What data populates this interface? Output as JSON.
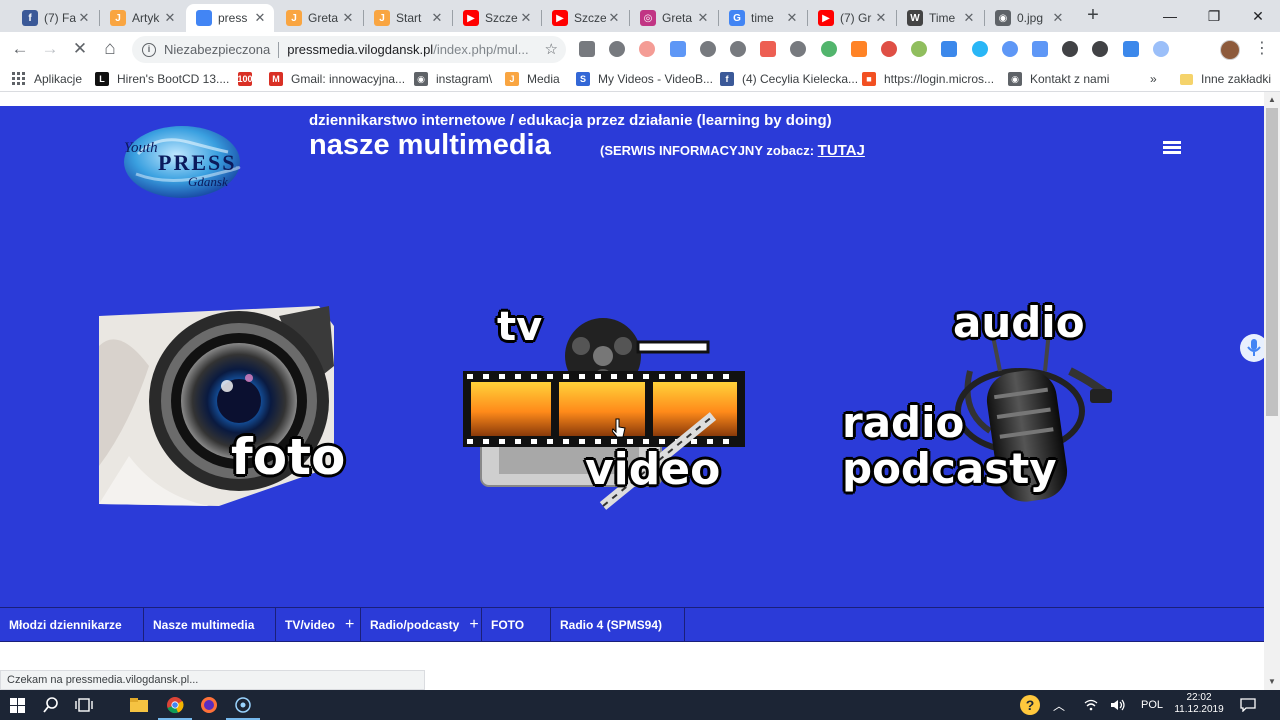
{
  "browser": {
    "tabs": [
      {
        "title": "(7) Fa",
        "icon": "facebook-icon",
        "color": "#3b5998",
        "glyph": "f"
      },
      {
        "title": "Artyk",
        "icon": "joomla-icon",
        "color": "#f9a541",
        "glyph": "J"
      },
      {
        "title": "press",
        "icon": "chrome-icon",
        "color": "#4285f4",
        "glyph": "",
        "active": true
      },
      {
        "title": "Greta",
        "icon": "joomla-icon",
        "color": "#f9a541",
        "glyph": "J"
      },
      {
        "title": "Start",
        "icon": "joomla-icon",
        "color": "#f9a541",
        "glyph": "J"
      },
      {
        "title": "Szcze",
        "icon": "youtube-icon",
        "color": "#ff0000",
        "glyph": "▶"
      },
      {
        "title": "Szcze",
        "icon": "youtube-icon",
        "color": "#ff0000",
        "glyph": "▶"
      },
      {
        "title": "Greta",
        "icon": "instagram-icon",
        "color": "#c13584",
        "glyph": "◎"
      },
      {
        "title": "time",
        "icon": "google-icon",
        "color": "#4285f4",
        "glyph": "G"
      },
      {
        "title": "(7) Gr",
        "icon": "youtube-icon",
        "color": "#ff0000",
        "glyph": "▶"
      },
      {
        "title": "Time",
        "icon": "wikipedia-icon",
        "color": "#444444",
        "glyph": "W"
      },
      {
        "title": "0.jpg",
        "icon": "globe-icon",
        "color": "#5f6368",
        "glyph": "◉"
      }
    ],
    "new_tab": "+",
    "window": {
      "minimize": "—",
      "restore": "❐",
      "close": "✕"
    },
    "nav": {
      "back": "←",
      "forward": "→",
      "stop": "✕",
      "home": "⌂"
    },
    "omnibox": {
      "security_label": "Niezabezpieczona",
      "host": "pressmedia.vilogdansk.pl",
      "path": "/index.php/mul...",
      "star": "☆"
    },
    "bookmarks": [
      {
        "label": "Aplikacje",
        "icon": "apps-grid-icon",
        "color": "#ea4335"
      },
      {
        "label": "Hiren's BootCD 13....",
        "icon": "hirens-icon",
        "color": "#111111",
        "glyph": "L"
      },
      {
        "label": "",
        "icon": "100plus-icon",
        "color": "#d93025",
        "glyph": "100"
      },
      {
        "label": "Gmail: innowacyjna...",
        "icon": "gmail-icon",
        "color": "#d93025",
        "glyph": "M"
      },
      {
        "label": "instagram\\",
        "icon": "globe-icon",
        "color": "#5f6368",
        "glyph": "◉"
      },
      {
        "label": "Media",
        "icon": "joomla-icon",
        "color": "#f9a541",
        "glyph": "J"
      },
      {
        "label": "My Videos - VideoB...",
        "icon": "videob-icon",
        "color": "#3367d6",
        "glyph": "S"
      },
      {
        "label": "(4) Cecylia Kielecka...",
        "icon": "facebook-icon",
        "color": "#3b5998",
        "glyph": "f"
      },
      {
        "label": "https://login.micros...",
        "icon": "microsoft-icon",
        "color": "#f25022",
        "glyph": "■"
      },
      {
        "label": "Kontakt z nami",
        "icon": "globe-icon",
        "color": "#5f6368",
        "glyph": "◉"
      }
    ],
    "bookmarks_overflow": "»",
    "other_bookmarks": "Inne zakładki",
    "status_text": "Czekam na pressmedia.vilogdansk.pl..."
  },
  "site": {
    "logo_text": {
      "line1": "Youth",
      "line2": "PRESS",
      "line3": "Gdansk"
    },
    "tagline": "dziennikarstwo internetowe / edukacja przez działanie (learning by doing)",
    "title": "nasze multimedia",
    "subtitle_prefix": "(SERWIS INFORMACYJNY zobacz:",
    "subtitle_link": "TUTAJ",
    "tiles": {
      "foto": "foto",
      "tv": "tv",
      "video": "video",
      "audio": "audio",
      "radio": "radio",
      "podcasty": "podcasty"
    },
    "menu": [
      {
        "label": "Młodzi dziennikarze",
        "plus": false
      },
      {
        "label": "Nasze multimedia",
        "plus": false
      },
      {
        "label": "TV/video",
        "plus": true
      },
      {
        "label": "Radio/podcasty",
        "plus": true
      },
      {
        "label": "FOTO",
        "plus": false
      },
      {
        "label": "Radio 4 (SPMS94)",
        "plus": false
      }
    ],
    "colors": {
      "background": "#2b3bd8",
      "text": "#ffffff"
    }
  },
  "taskbar": {
    "language": "POL",
    "time": "22:02",
    "date": "11.12.2019"
  }
}
